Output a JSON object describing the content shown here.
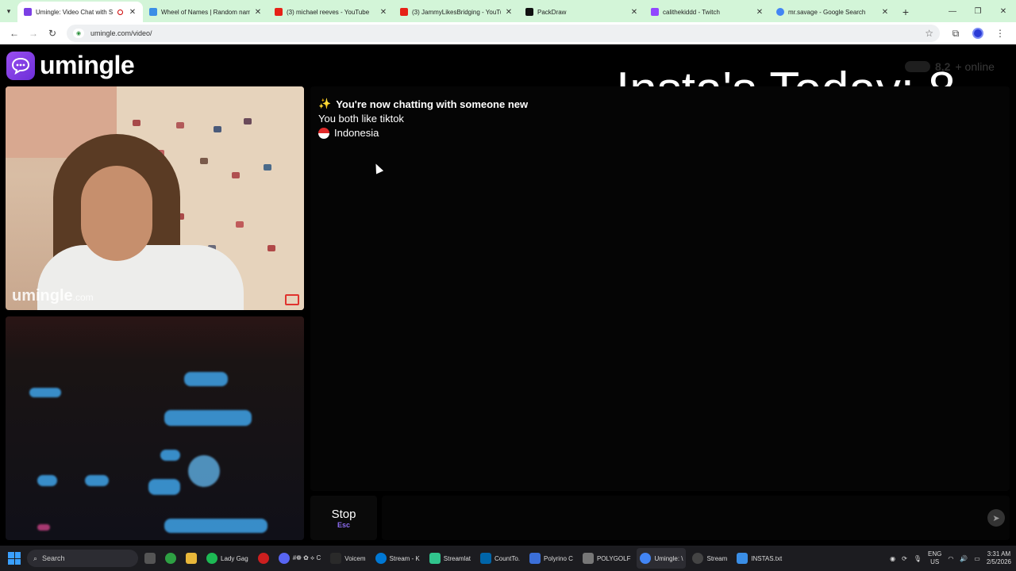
{
  "browser": {
    "tabs": [
      {
        "label": "Umingle: Video Chat with S",
        "color": "#7b3fe4",
        "active": true
      },
      {
        "label": "Wheel of Names | Random nam",
        "color": "#3a8ee6"
      },
      {
        "label": "(3) michael reeves - YouTube",
        "color": "#e62117"
      },
      {
        "label": "(3) JammyLikesBridging - YouTu",
        "color": "#e62117"
      },
      {
        "label": "PackDraw",
        "color": "#111111"
      },
      {
        "label": "calithekiddd - Twitch",
        "color": "#9146ff"
      },
      {
        "label": "mr.savage - Google Search",
        "color": "#4285f4"
      }
    ],
    "url": "umingle.com/video/"
  },
  "page": {
    "logo_text": "umingle",
    "online_count": "8,2",
    "online_label": "+ online",
    "insta_counter": "Insta's Today:  8",
    "watermark_main": "umingle",
    "watermark_suffix": ".com",
    "chat": {
      "line1": "You're now chatting with someone new",
      "line1_icon": "✨",
      "line2": "You both like tiktok",
      "line3": "Indonesia"
    },
    "stop_label": "Stop",
    "stop_key": "Esc",
    "send_icon": "send-icon"
  },
  "taskbar": {
    "search_label": "Search",
    "apps": [
      {
        "label": "Lady Gag",
        "color": "#1db954"
      },
      {
        "label": "",
        "color": "#cc1f1f"
      },
      {
        "label": "#❁ ✿ ⟡ C",
        "color": "#5865f2"
      },
      {
        "label": "Voicem",
        "color": "#2a2a2a"
      },
      {
        "label": "Stream - K",
        "color": "#0078d4"
      },
      {
        "label": "Streamlat",
        "color": "#31c48d"
      },
      {
        "label": "CountTo.",
        "color": "#0065a9"
      },
      {
        "label": "Polyrino C",
        "color": "#3b6fd8"
      },
      {
        "label": "POLYGOLF",
        "color": "#777777"
      },
      {
        "label": "Umingle: \\",
        "color": "#4285f4"
      },
      {
        "label": "Stream",
        "color": "#444444"
      },
      {
        "label": "INSTAS.txt",
        "color": "#3a8ee6"
      }
    ],
    "lang_top": "ENG",
    "lang_bottom": "US",
    "time": "3:31 AM",
    "date": "2/5/2026"
  }
}
